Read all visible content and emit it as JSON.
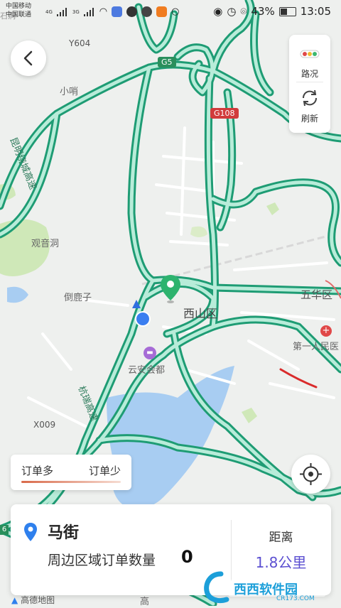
{
  "status_bar": {
    "carrier1": "中国移动",
    "carrier2": "中国联通",
    "net1": "4G",
    "net2": "3G",
    "battery": "43%",
    "time": "13:05"
  },
  "side_panel": {
    "traffic_label": "路况",
    "refresh_label": "刷新"
  },
  "map": {
    "labels": {
      "y604": "Y604",
      "xiaoshao": "小哨",
      "g5": "G5",
      "g108": "G108",
      "kunming_ring": "昆明绕城高速",
      "guanyindong": "观音洞",
      "daoluzi": "倒鹿子",
      "xishan": "西山区",
      "wuhua": "五华区",
      "hospital": "第一人民医",
      "yunan": "云安会都",
      "hangrui": "杭瑞高速",
      "x009": "X009",
      "gaode": "高德地图",
      "gao": "高",
      "left_edge": "石洞",
      "left_badge": "6"
    }
  },
  "legend": {
    "more": "订单多",
    "less": "订单少"
  },
  "card": {
    "title": "马街",
    "subtitle": "周边区域订单数量",
    "count": "0",
    "distance_label": "距离",
    "distance_value": "1.8公里"
  },
  "watermark": {
    "text": "西西软件园",
    "url": "CR173.COM"
  },
  "colors": {
    "road_outline": "#1e9c74",
    "road_fill": "#b8ecd9",
    "accent": "#5b4fd1",
    "pin_green": "#2db36e",
    "water": "#a8cdf2"
  }
}
